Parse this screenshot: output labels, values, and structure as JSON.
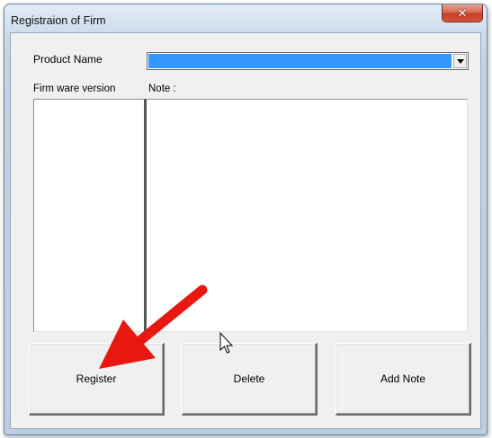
{
  "window": {
    "title": "Registraion of Firm",
    "close_icon": "close-icon"
  },
  "form": {
    "product_label": "Product Name",
    "product_value": "",
    "firmware_label": "Firm ware version",
    "note_label": "Note :",
    "firmware_items": [],
    "note_text": ""
  },
  "buttons": {
    "register": "Register",
    "delete": "Delete",
    "add_note": "Add Note"
  },
  "overlay": {
    "arrow_color": "#e8170f",
    "arrow_icon": "red-arrow-icon",
    "cursor_icon": "mouse-pointer-icon"
  },
  "colors": {
    "selection": "#3399ff",
    "close_button": "#c3402a"
  }
}
